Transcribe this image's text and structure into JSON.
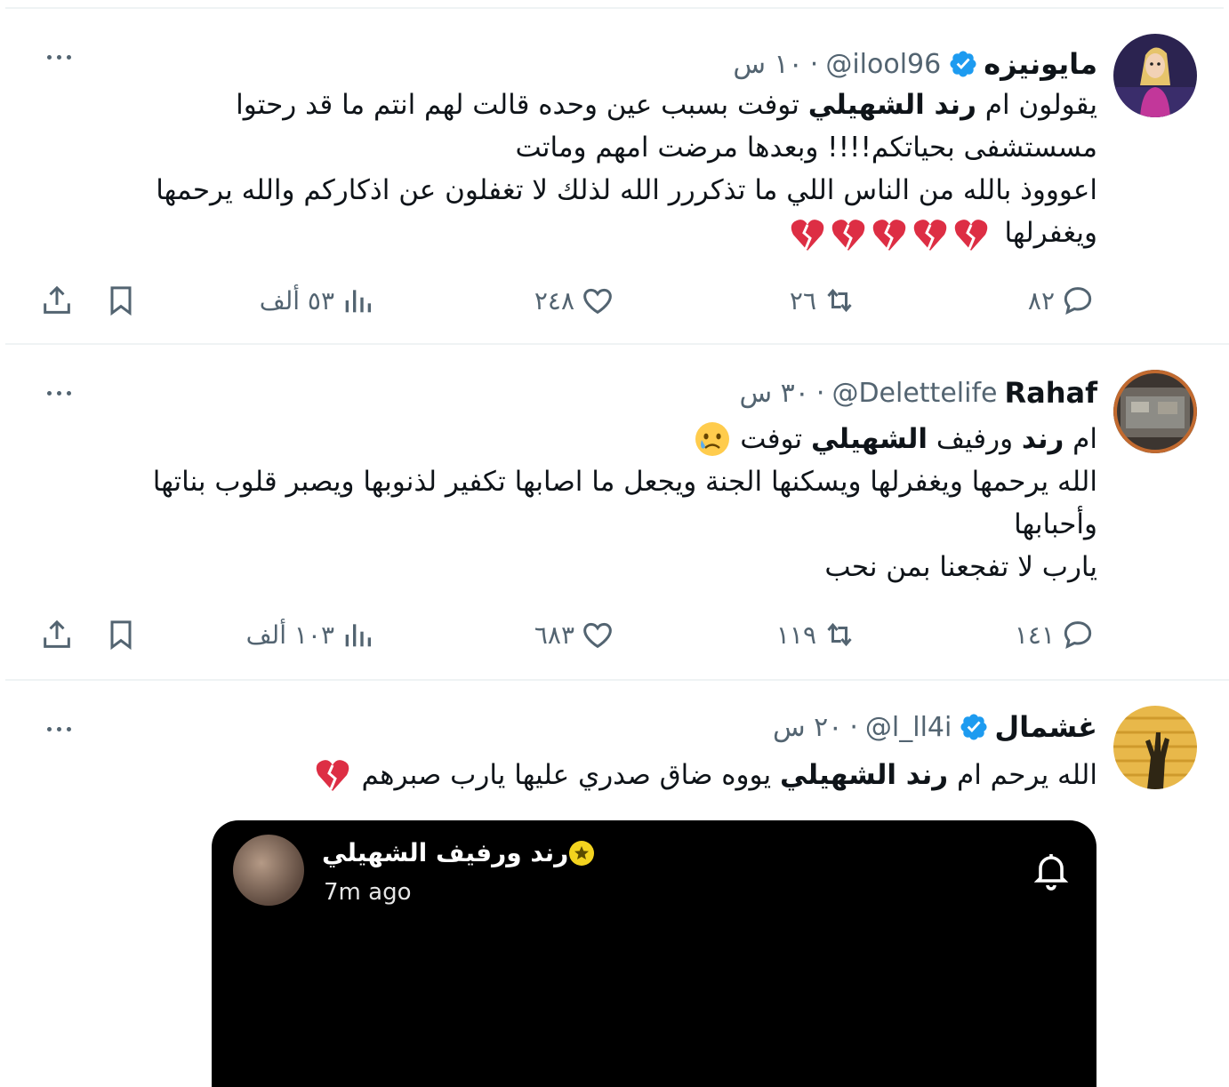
{
  "tweets": [
    {
      "name": "مايونيزه",
      "verified": true,
      "handle": "@ilool96",
      "time": "١٠ س",
      "body": {
        "l1_a": "يقولون ام ",
        "l1_b": "رند الشهيلي",
        "l1_c": " توفت بسبب عين وحده قالت لهم انتم ما قد رحتوا",
        "l2": "مسستشفى بحياتكم!!!! وبعدها مرضت امهم  وماتت",
        "l3": "اعوووذ بالله من الناس اللي ما تذكررر الله لذلك لا تغفلون عن اذكاركم والله يرحمها",
        "l4": "ويغفرلها"
      },
      "emoji": "broken-heart x5",
      "replies": "٨٢",
      "retweets": "٢٦",
      "likes": "٢٤٨",
      "views": "٥٣ ألف"
    },
    {
      "name": "Rahaf",
      "verified": false,
      "handle": "@Delettelife",
      "time": "٣٠ س",
      "body": {
        "l1_a": "ام ",
        "l1_b": "رند",
        "l1_c": " ورفيف ",
        "l1_d": "الشهيلي",
        "l1_e": " توفت",
        "l2": "الله يرحمها ويغفرلها ويسكنها الجنة ويجعل ما اصابها تكفير لذنوبها ويصبر قلوب بناتها",
        "l3": "وأحبابها",
        "l4": "يارب لا تفجعنا بمن نحب"
      },
      "emoji": "crying-face",
      "replies": "١٤١",
      "retweets": "١١٩",
      "likes": "٦٨٣",
      "views": "١٠٣ ألف"
    },
    {
      "name": "غشمال",
      "verified": true,
      "handle": "@l_ll4i",
      "time": "٢٠ س",
      "body": {
        "l1_a": "الله يرحم ام ",
        "l1_b": "رند الشهيلي",
        "l1_c": " يووه ضاق صدري عليها يارب صبرهم"
      },
      "emoji": "broken-heart",
      "embed": {
        "name": "رند ورفيف الشهيلي",
        "time": "7m ago"
      }
    }
  ],
  "colors": {
    "verified": "#1d9bf0",
    "muted": "#536471",
    "heart_red": "#dd2e44"
  },
  "icons": [
    "reply-icon",
    "retweet-icon",
    "like-icon",
    "views-icon",
    "bookmark-icon",
    "share-icon",
    "more-icon",
    "verified-icon",
    "bell-icon"
  ]
}
